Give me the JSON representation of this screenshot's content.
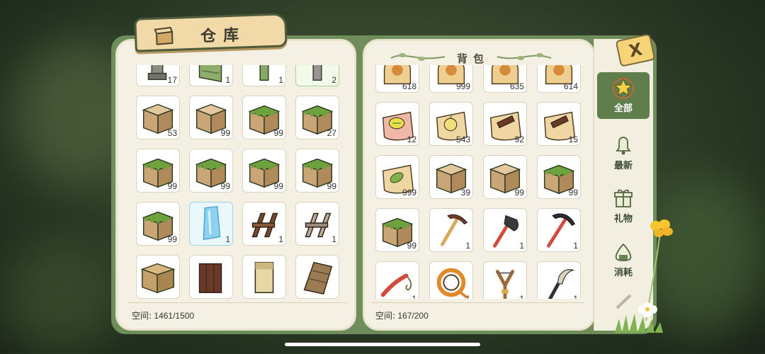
{
  "warehouse": {
    "title": "仓库",
    "space_label": "空间:",
    "space_value": "1461/1500",
    "items": [
      {
        "icon": "stone-pillar-icon",
        "count": "17"
      },
      {
        "icon": "mossy-stone-slab-icon",
        "count": "1"
      },
      {
        "icon": "mossy-post-icon",
        "count": "1"
      },
      {
        "icon": "stone-post-icon",
        "count": "2",
        "selected": "green"
      },
      {
        "icon": "dirt-block-icon",
        "count": "53"
      },
      {
        "icon": "dirt-block-icon",
        "count": "99"
      },
      {
        "icon": "grass-block-icon",
        "count": "99"
      },
      {
        "icon": "grass-block-icon",
        "count": "27"
      },
      {
        "icon": "grass-block-icon",
        "count": "99"
      },
      {
        "icon": "grass-block-icon",
        "count": "99"
      },
      {
        "icon": "grass-block-icon",
        "count": "99"
      },
      {
        "icon": "grass-block-icon",
        "count": "99"
      },
      {
        "icon": "grass-block-icon",
        "count": "99"
      },
      {
        "icon": "ice-crystal-icon",
        "count": "1",
        "selected": "blue"
      },
      {
        "icon": "wooden-bench-icon",
        "count": "1"
      },
      {
        "icon": "stone-bench-icon",
        "count": "1"
      },
      {
        "icon": "wood-plank-block-icon",
        "count": ""
      },
      {
        "icon": "dark-wood-block-icon",
        "count": ""
      },
      {
        "icon": "birch-log-icon",
        "count": ""
      },
      {
        "icon": "wood-floor-icon",
        "count": ""
      }
    ]
  },
  "backpack": {
    "title": "背包",
    "space_label": "空间:",
    "space_value": "167/200",
    "items": [
      {
        "icon": "seed-bag-icon",
        "count": "618"
      },
      {
        "icon": "seed-bag-icon",
        "count": "999"
      },
      {
        "icon": "seed-bag-icon",
        "count": "635"
      },
      {
        "icon": "seed-bag-icon",
        "count": "614"
      },
      {
        "icon": "lemon-seed-bag-icon",
        "count": "12"
      },
      {
        "icon": "fruit-seed-bag-icon",
        "count": "543"
      },
      {
        "icon": "wood-seed-bag-icon",
        "count": "92"
      },
      {
        "icon": "wood-seed-bag-icon",
        "count": "15"
      },
      {
        "icon": "leaf-seed-bag-icon",
        "count": "999"
      },
      {
        "icon": "dirt-block-icon",
        "count": "39"
      },
      {
        "icon": "dirt-block-icon",
        "count": "99"
      },
      {
        "icon": "grass-block-icon",
        "count": "99"
      },
      {
        "icon": "grass-block-icon",
        "count": "99"
      },
      {
        "icon": "pickaxe-icon",
        "count": "1"
      },
      {
        "icon": "axe-icon",
        "count": "1"
      },
      {
        "icon": "pickaxe-red-icon",
        "count": "1"
      },
      {
        "icon": "whip-icon",
        "count": "1"
      },
      {
        "icon": "rope-icon",
        "count": "1"
      },
      {
        "icon": "slingshot-icon",
        "count": "1"
      },
      {
        "icon": "sickle-icon",
        "count": "1"
      }
    ]
  },
  "sidebar": {
    "close_label": "X",
    "tabs": [
      {
        "label": "全部",
        "icon": "star-icon",
        "active": true
      },
      {
        "label": "最新",
        "icon": "bell-icon",
        "active": false
      },
      {
        "label": "礼物",
        "icon": "gift-icon",
        "active": false
      },
      {
        "label": "消耗",
        "icon": "rice-ball-icon",
        "active": false
      }
    ]
  }
}
